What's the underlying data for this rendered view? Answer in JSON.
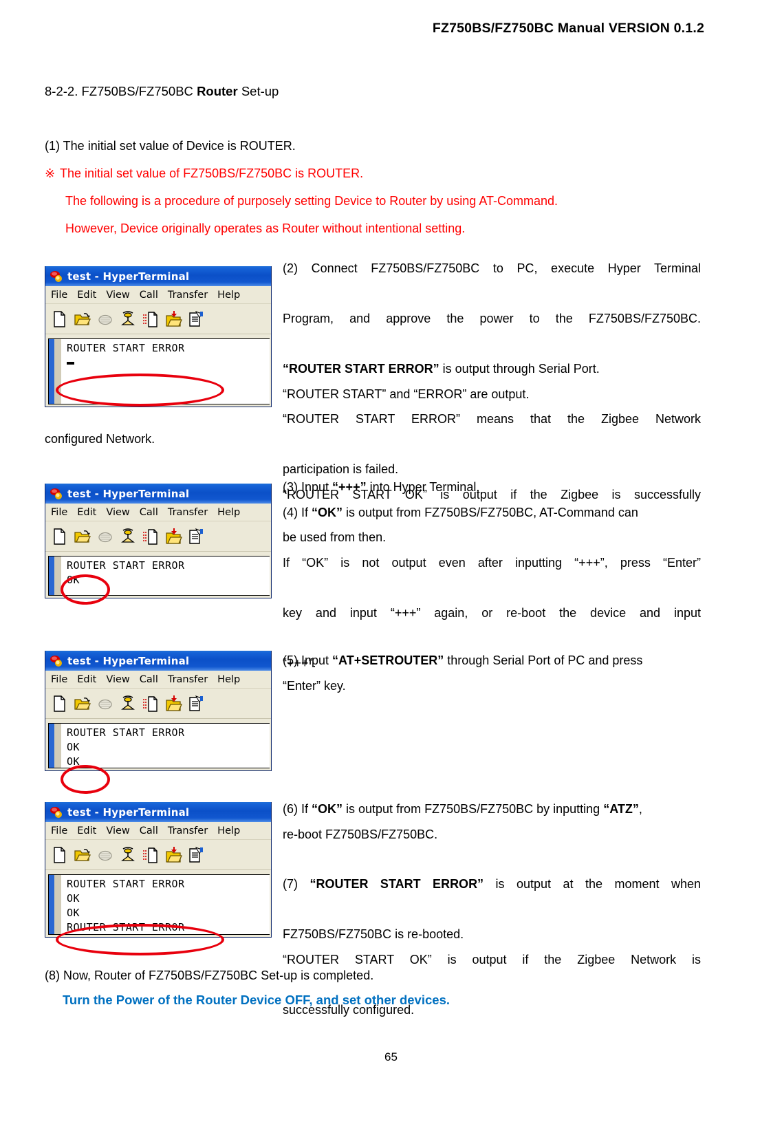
{
  "document": {
    "header": "FZ750BS/FZ750BC Manual VERSION 0.1.2",
    "page_number": "65",
    "section_number": "8-2-2. FZ750BS/FZ750BC ",
    "section_bold": "Router",
    "section_tail": " Set-up"
  },
  "intro": {
    "item1": "(1) The initial set value of Device is ROUTER.",
    "note_mark": "※",
    "note1": "The initial set value of FZ750BS/FZ750BC is ROUTER.",
    "note2": "The following is a procedure of purposely setting Device to Router by using AT-Command.",
    "note3": "However, Device originally operates as Router without intentional setting."
  },
  "steps": {
    "step2_l1": "(2) Connect FZ750BS/FZ750BC to PC, execute Hyper Terminal",
    "step2_l2": "Program, and approve the power to the FZ750BS/FZ750BC.",
    "step2_l3_bold": "“ROUTER START ERROR”",
    "step2_l3_rest": " is output through Serial Port.",
    "step2_l4": "“ROUTER START” and “ERROR” are output.",
    "step2_l5": "“ROUTER START ERROR” means that the Zigbee Network",
    "step2_l6": "participation is failed.",
    "step2_l7": "“ROUTER START OK” is output if the Zigbee is successfully",
    "step2_l8": "configured Network.",
    "step3_pre": "(3) Input ",
    "step3_bold": "“+++”",
    "step3_post": " into Hyper Terminal.",
    "step4_pre": "(4) If ",
    "step4_bold": "“OK”",
    "step4_post": " is output from FZ750BS/FZ750BC, AT-Command can",
    "step4_l2": "be used from then.",
    "step4_l3": "If “OK” is not output even after inputting “+++”, press “Enter”",
    "step4_l4": "key and input “+++” again, or re-boot the device and input",
    "step4_l5": "“+++”.",
    "step5_pre": "(5) Input ",
    "step5_bold": "“AT+SETROUTER”",
    "step5_post": " through Serial Port of PC and press",
    "step5_l2": "“Enter” key.",
    "step6_pre": "(6) If ",
    "step6_bold1": "“OK”",
    "step6_mid": " is output from FZ750BS/FZ750BC by inputting ",
    "step6_bold2": "“ATZ”",
    "step6_post": ",",
    "step6_l2": "re-boot FZ750BS/FZ750BC.",
    "step7_pre": "(7) ",
    "step7_bold": "“ROUTER START ERROR”",
    "step7_post": " is output at the moment when",
    "step7_l2": "FZ750BS/FZ750BC is re-booted.",
    "step7_l3": "“ROUTER START OK” is output if the Zigbee Network is",
    "step7_l4": "successfully configured.",
    "step8": "(8) Now, Router of FZ750BS/FZ750BC Set-up is completed.",
    "closing_note": "Turn the Power of the Router Device OFF, and set other devices."
  },
  "terminal_window": {
    "title": "test - HyperTerminal",
    "menu": [
      "File",
      "Edit",
      "View",
      "Call",
      "Transfer",
      "Help"
    ],
    "toolbar_icons": [
      "new-connection-icon",
      "open-icon",
      "disconnect-icon",
      "call-icon",
      "send-file-icon",
      "receive-file-icon",
      "properties-icon"
    ]
  },
  "terminals": [
    {
      "id": "terminal-1",
      "lines": [
        "ROUTER START ERROR"
      ],
      "caret": true,
      "highlight_line": 0
    },
    {
      "id": "terminal-2",
      "lines": [
        "ROUTER START ERROR",
        "OK"
      ],
      "caret": false,
      "highlight_line": 1
    },
    {
      "id": "terminal-3",
      "lines": [
        "ROUTER START ERROR",
        "OK",
        "OK"
      ],
      "caret": false,
      "highlight_line": 2
    },
    {
      "id": "terminal-4",
      "lines": [
        "ROUTER START ERROR",
        "OK",
        "OK",
        "ROUTER START ERROR"
      ],
      "caret": false,
      "highlight_line": 3
    }
  ],
  "colors": {
    "red_note": "#ff0000",
    "blue_note": "#0070c0",
    "annotation_red": "#e8000d",
    "titlebar_blue": "#0b50c8"
  }
}
